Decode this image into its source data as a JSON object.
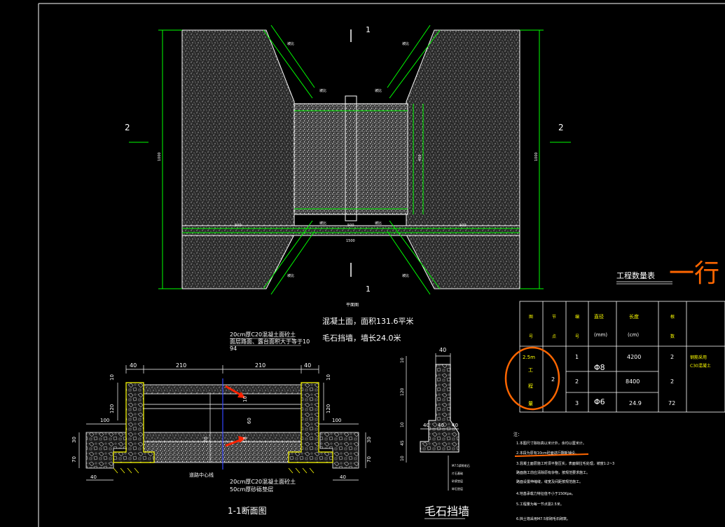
{
  "plan": {
    "section_mark_top": "1",
    "section_mark_bottom": "1",
    "side_mark_left": "2",
    "side_mark_right": "2",
    "title": "平面图",
    "dim_total_width": "1500",
    "dim_left_segment": "500",
    "dim_mid_segment": "500",
    "dim_right_segment": "500",
    "dim_left_height": "1000",
    "dim_right_height": "1000",
    "dim_inner_height": "400",
    "slope_label": "坡比"
  },
  "notes_main": {
    "line1": "混凝土面，面积131.6平米",
    "line2": "毛石挡墙，墙长24.0米"
  },
  "section_1_1": {
    "title": "1-1断面图",
    "top_note_1": "20cm厚C20混凝土面砼土",
    "top_note_2": "面层路面、露台面积大于等于10",
    "top_note_3": "94",
    "bottom_note_1": "20cm厚C20混凝土面砼土",
    "bottom_note_2": "50cm厚砂砾垫层",
    "center_label": "道路中心线",
    "dim_40_left": "40",
    "dim_210_left": "210",
    "dim_210_right": "210",
    "dim_40_right": "40",
    "dim_10_l": "10",
    "dim_120_l": "120",
    "dim_10_r": "10",
    "dim_120_r": "120",
    "dim_100_l": "100",
    "dim_100_r": "100",
    "dim_30_l": "30",
    "dim_70_l": "70",
    "dim_30_r": "30",
    "dim_70_r": "70",
    "dim_40_bl": "40",
    "dim_40_br": "40",
    "dim_60": "60",
    "dim_20": "20",
    "arrow_label_1": "10",
    "arrow_label_2": "18"
  },
  "wall": {
    "title": "毛石挡墙",
    "dim_top": "40",
    "dim_10a": "10",
    "dim_120": "120",
    "dim_10b": "10",
    "dim_45": "45",
    "dim_10c": "10",
    "dim_40_l": "40",
    "dim_40_m": "40",
    "dim_40_r": "40",
    "note_1": "M7.5浆砌毛石",
    "note_2": "片石基础",
    "note_3": "砂浆垫层",
    "note_4": "碎石垫层"
  },
  "table": {
    "title": "工程数量表",
    "handwritten_note": "一行",
    "headers": [
      "图号",
      "节点",
      "编号",
      "直径(mm)",
      "长度(cm)",
      "根数",
      ""
    ],
    "hdr_col1_a": "图",
    "hdr_col1_b": "号",
    "hdr_col2_a": "节",
    "hdr_col2_b": "点",
    "hdr_col3_a": "编",
    "hdr_col3_b": "号",
    "hdr_col4_a": "直径",
    "hdr_col4_b": "(mm)",
    "hdr_col5_a": "长度",
    "hdr_col5_b": "(cm)",
    "hdr_col6_a": "根",
    "hdr_col6_b": "数",
    "group_label_1": "2.5m",
    "group_label_2": "工",
    "group_label_3": "程",
    "group_label_4": "量",
    "node_value": "2",
    "rows": [
      {
        "no": "1",
        "dia": "Φ8",
        "len": "4200",
        "count": "2"
      },
      {
        "no": "2",
        "dia": "",
        "len": "8400",
        "count": "2"
      },
      {
        "no": "3",
        "dia": "Φ6",
        "len": "24.9",
        "count": "72"
      }
    ],
    "remark_1": "钢筋采用",
    "remark_2": "C30混凝土"
  },
  "notes": {
    "heading": "注：",
    "n1": "1.本图尺寸除标高以米计外，余均以厘米计。",
    "n2": "2.本段为原有10cm砼面进行翻新铺设。",
    "n3": "3.混凝土面层施工时须平整压实，表面做拉毛处理，坡度1:2~3",
    "n3b": "路面施工前应清除原有杂物，按规范要求施工。",
    "n3c": "路面设置伸缩缝，缝宽及间距按规范施工。",
    "n4": "4.地基承载力特征值不小于150Kpa。",
    "n5": "5.工程量为每一节点需2.5米。",
    "n6": "6.挡土墙采用M7.5浆砌毛石砌筑。"
  },
  "colors": {
    "background": "#000000",
    "hatch": "#ffffff",
    "dimension": "#00ff00",
    "wall": "#ffff00",
    "text": "#ffffff",
    "annotation": "#ff6600",
    "axis": "#0000ff"
  }
}
